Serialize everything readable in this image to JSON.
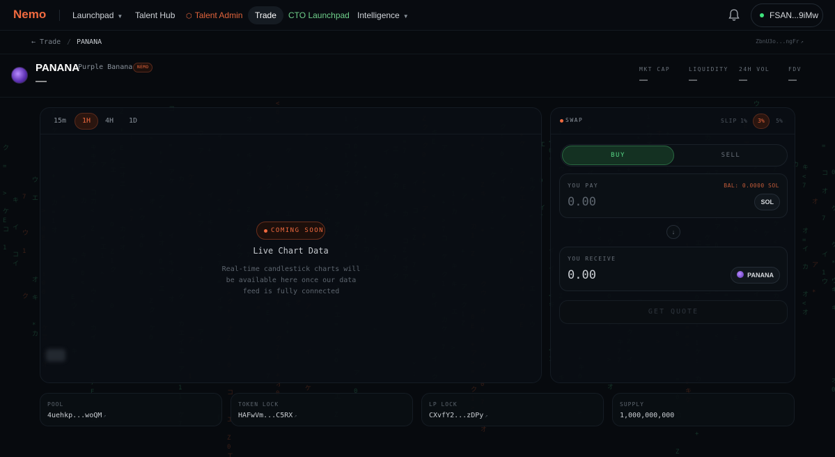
{
  "nav": {
    "logo": "Nemo",
    "items": [
      {
        "label": "Launchpad",
        "dropdown": true
      },
      {
        "label": "Talent Hub"
      },
      {
        "label": "Talent Admin",
        "accent": "#e2643c"
      },
      {
        "label": "Trade",
        "active": true
      },
      {
        "label": "CTO Launchpad",
        "accent": "#6fcf8a"
      },
      {
        "label": "Intelligence",
        "dropdown": true
      }
    ],
    "wallet": "FSAN...9iMw"
  },
  "breadcrumb": {
    "back": "← Trade",
    "separator": "/",
    "current": "PANANA",
    "address": "ZbnU3o...ngFr"
  },
  "token": {
    "symbol": "PANANA",
    "name": "Purple Banana",
    "badge": "NEMO",
    "price": "—",
    "stats": [
      {
        "label": "MKT CAP",
        "value": "—"
      },
      {
        "label": "LIQUIDITY",
        "value": "—"
      },
      {
        "label": "24H VOL",
        "value": "—"
      },
      {
        "label": "FDV",
        "value": "—"
      }
    ]
  },
  "chart": {
    "timeframes": [
      "15m",
      "1H",
      "4H",
      "1D"
    ],
    "active_timeframe": "1H",
    "badge": "COMING SOON",
    "title": "Live Chart Data",
    "description": "Real-time candlestick charts will be available here once our data feed is fully connected"
  },
  "swap": {
    "title": "SWAP",
    "slippage_label": "SLIP",
    "slippage_options": [
      "1%",
      "3%",
      "5%"
    ],
    "slippage_selected": "3%",
    "buy_label": "BUY",
    "sell_label": "SELL",
    "pay": {
      "label": "YOU PAY",
      "balance": "BAL: 0.0000 SOL",
      "amount": "0.00",
      "token": "SOL"
    },
    "receive": {
      "label": "YOU RECEIVE",
      "amount": "0.00",
      "token": "PANANA"
    },
    "quote_button": "GET QUOTE"
  },
  "info_cards": [
    {
      "label": "POOL",
      "value": "4uehkp...woQM"
    },
    {
      "label": "TOKEN LOCK",
      "value": "HAFwVm...C5RX"
    },
    {
      "label": "LP LOCK",
      "value": "CXvfY2...zDPy"
    },
    {
      "label": "SUPPLY",
      "value": "1,000,000,000"
    }
  ]
}
